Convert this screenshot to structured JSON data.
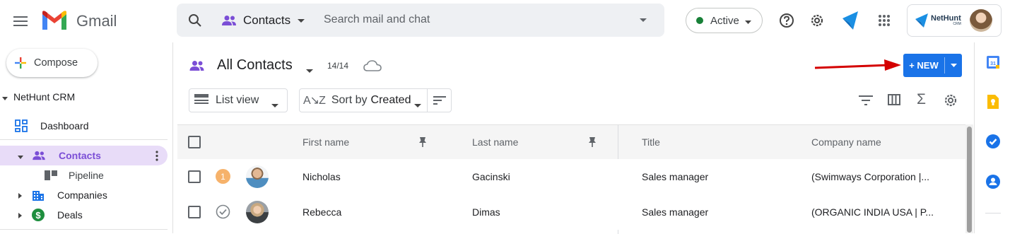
{
  "header": {
    "app_name": "Gmail",
    "search_scope": "Contacts",
    "search_placeholder": "Search mail and chat",
    "status": "Active",
    "brand_name": "NetHunt",
    "brand_sub": "CRM"
  },
  "sidebar": {
    "compose_label": "Compose",
    "section_title": "NetHunt CRM",
    "items": [
      {
        "label": "Dashboard"
      },
      {
        "label": "Contacts"
      },
      {
        "label": "Pipeline"
      },
      {
        "label": "Companies"
      },
      {
        "label": "Deals"
      }
    ]
  },
  "main": {
    "view_title": "All Contacts",
    "record_count": "14/14",
    "new_button_label": "+ NEW",
    "list_view_label": "List view",
    "sort_prefix": "Sort by",
    "sort_field": "Created",
    "columns": [
      "First name",
      "Last name",
      "Title",
      "Company name"
    ],
    "rows": [
      {
        "badge": "1",
        "first_name": "Nicholas",
        "last_name": "Gacinski",
        "title": "Sales manager",
        "company": "(Swimways Corporation |..."
      },
      {
        "badge": "",
        "first_name": "Rebecca",
        "last_name": "Dimas",
        "title": "Sales manager",
        "company": "(ORGANIC INDIA USA | P..."
      }
    ]
  },
  "colors": {
    "accent_blue": "#1a73e8",
    "contacts_purple": "#7b4ed6",
    "active_green": "#188038",
    "badge_orange": "#f6b26b",
    "arrow_red": "#d40000",
    "selected_bg": "#e8dcf8"
  },
  "icons": {
    "calendar": "calendar-icon",
    "keep": "keep-icon",
    "tasks": "tasks-icon",
    "contacts": "contacts-icon"
  }
}
